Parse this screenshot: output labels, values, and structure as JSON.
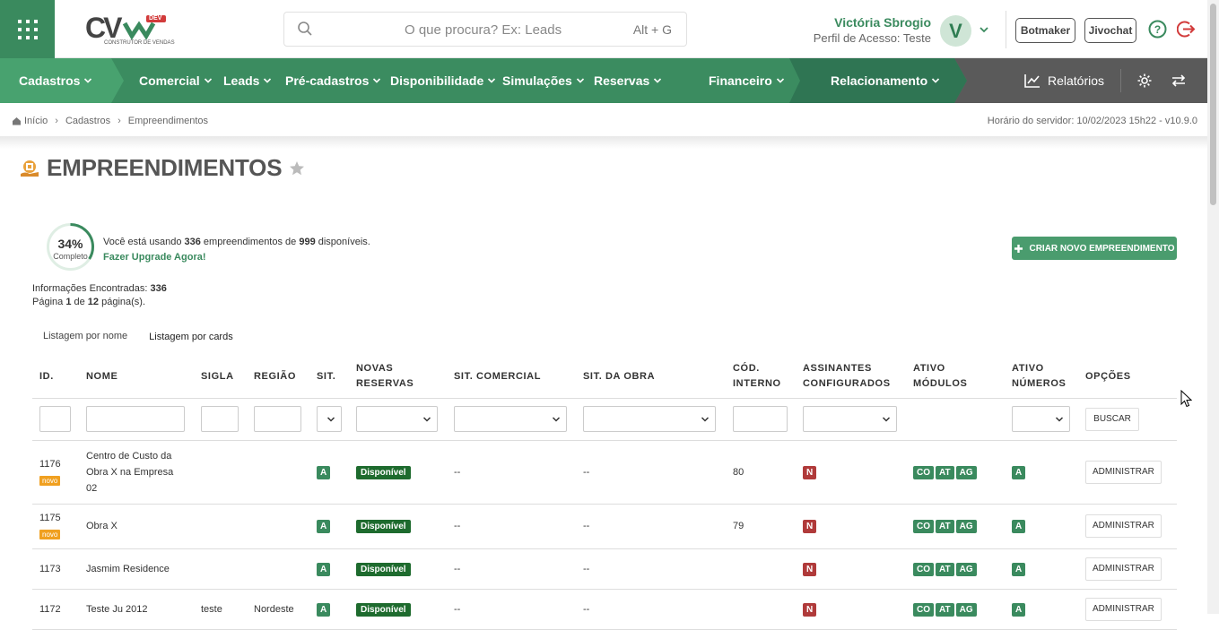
{
  "search": {
    "placeholder": "O que procura? Ex: Leads",
    "shortcut": "Alt + G"
  },
  "user": {
    "name": "Victória Sbrogio",
    "profile": "Perfil de Acesso: Teste",
    "initial": "V"
  },
  "header_buttons": {
    "botmaker": "Botmaker",
    "jivochat": "Jivochat"
  },
  "logo": {
    "text": "CV",
    "sub": "CONSTRUTOR DE VENDAS",
    "tag": "DEV"
  },
  "nav": {
    "items": [
      "Cadastros",
      "Comercial",
      "Leads",
      "Pré-cadastros",
      "Disponibilidade",
      "Simulações",
      "Reservas",
      "Financeiro",
      "Relacionamento"
    ],
    "reports": "Relatórios"
  },
  "breadcrumb": {
    "items": [
      "Início",
      "Cadastros",
      "Empreendimentos"
    ],
    "server_time": "Horário do servidor: 10/02/2023 15h22 - v10.9.0"
  },
  "page": {
    "title": "EMPREENDIMENTOS"
  },
  "usage": {
    "percent": "34%",
    "percent_value": 34,
    "complete": "Completo",
    "text_pre": "Você está usando ",
    "used": "336",
    "text_mid": " empreendimentos de ",
    "total": "999",
    "text_post": " disponíveis.",
    "upgrade": "Fazer Upgrade Agora!"
  },
  "new_button": "CRIAR NOVO EMPREENDIMENTO",
  "info": {
    "found_label": "Informações Encontradas: ",
    "found": "336",
    "page_pre": "Página ",
    "page": "1",
    "page_mid": " de ",
    "pages": "12",
    "page_post": " página(s)."
  },
  "tabs": [
    "Listagem por nome",
    "Listagem por cards"
  ],
  "table": {
    "headers": [
      "ID.",
      "NOME",
      "SIGLA",
      "REGIÃO",
      "SIT.",
      "NOVAS RESERVAS",
      "SIT. COMERCIAL",
      "SIT. DA OBRA",
      "CÓD. INTERNO",
      "ASSINANTES CONFIGURADOS",
      "ATIVO MÓDULOS",
      "ATIVO NÚMEROS",
      "OPÇÕES"
    ],
    "search_button": "BUSCAR",
    "rows": [
      {
        "id": "1176",
        "novo": "novo",
        "name": "Centro de Custo da Obra X na Empresa 02",
        "sigla": "",
        "regiao": "",
        "sit": "A",
        "novas": "Disponível",
        "sit_com": "--",
        "sit_obra": "--",
        "cod": "80",
        "assin": "N",
        "mod": [
          "CO",
          "AT",
          "AG"
        ],
        "num": "A",
        "opt": "ADMINISTRAR"
      },
      {
        "id": "1175",
        "novo": "novo",
        "name": "Obra X",
        "sigla": "",
        "regiao": "",
        "sit": "A",
        "novas": "Disponível",
        "sit_com": "--",
        "sit_obra": "--",
        "cod": "79",
        "assin": "N",
        "mod": [
          "CO",
          "AT",
          "AG"
        ],
        "num": "A",
        "opt": "ADMINISTRAR"
      },
      {
        "id": "1173",
        "novo": "",
        "name": "Jasmim Residence",
        "sigla": "",
        "regiao": "",
        "sit": "A",
        "novas": "Disponível",
        "sit_com": "--",
        "sit_obra": "--",
        "cod": "",
        "assin": "N",
        "mod": [
          "CO",
          "AT",
          "AG"
        ],
        "num": "A",
        "opt": "ADMINISTRAR"
      },
      {
        "id": "1172",
        "novo": "",
        "name": "Teste Ju 2012",
        "sigla": "teste",
        "regiao": "Nordeste",
        "sit": "A",
        "novas": "Disponível",
        "sit_com": "--",
        "sit_obra": "--",
        "cod": "",
        "assin": "N",
        "mod": [
          "CO",
          "AT",
          "AG"
        ],
        "num": "A",
        "opt": "ADMINISTRAR"
      }
    ]
  },
  "colors": {
    "brand": "#3a8a5e",
    "nav": "#3b8c60",
    "nav_active": "#48a26f",
    "danger": "#b03a3a",
    "badge_dark": "#1e6b2e"
  }
}
